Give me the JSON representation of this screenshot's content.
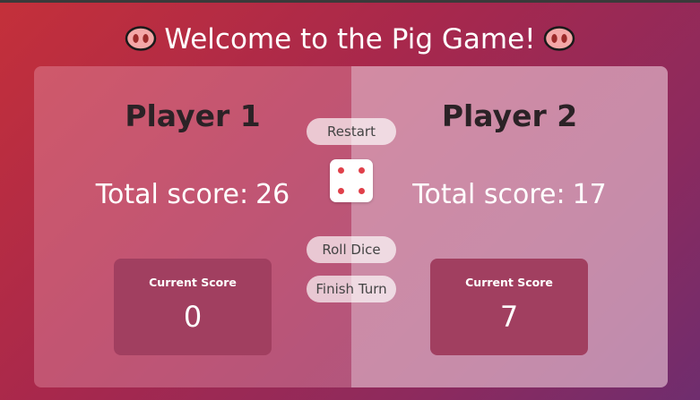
{
  "title": "Welcome to the Pig Game!",
  "players": [
    {
      "name": "Player 1",
      "total_label": "Total score:",
      "total": "26",
      "current_label": "Current Score",
      "current": "0",
      "active": true
    },
    {
      "name": "Player 2",
      "total_label": "Total score:",
      "total": "17",
      "current_label": "Current Score",
      "current": "7",
      "active": false
    }
  ],
  "buttons": {
    "restart": "Restart",
    "roll": "Roll Dice",
    "finish": "Finish Turn"
  },
  "dice": {
    "value": 4,
    "icon": "dice-four-icon",
    "pip_color": "#e0404a"
  },
  "colors": {
    "accent": "#a13f60"
  }
}
